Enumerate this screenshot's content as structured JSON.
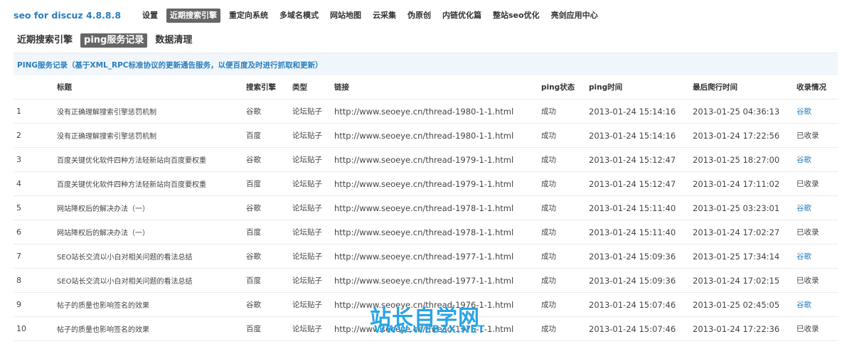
{
  "app": {
    "brand": "seo for discuz 4.8.8.8"
  },
  "topnav": [
    {
      "label": "设置",
      "active": false
    },
    {
      "label": "近期搜索引擎",
      "active": true
    },
    {
      "label": "重定向系统",
      "active": false
    },
    {
      "label": "多域名模式",
      "active": false
    },
    {
      "label": "网站地图",
      "active": false
    },
    {
      "label": "云采集",
      "active": false
    },
    {
      "label": "伪原创",
      "active": false
    },
    {
      "label": "内链优化篇",
      "active": false
    },
    {
      "label": "整站seo优化",
      "active": false
    },
    {
      "label": "亮剑应用中心",
      "active": false
    }
  ],
  "subnav": [
    {
      "label": "近期搜索引擎",
      "active": false
    },
    {
      "label": "ping服务记录",
      "active": true
    },
    {
      "label": "数据清理",
      "active": false
    }
  ],
  "panel": {
    "title": "PING服务记录（基于XML_RPC标准协议的更新通告服务，以便百度及时进行抓取和更新）"
  },
  "table": {
    "headers": [
      "",
      "标题",
      "搜索引擎",
      "类型",
      "链接",
      "ping状态",
      "ping时间",
      "最后爬行时间",
      "收录情况"
    ],
    "rows": [
      {
        "idx": "1",
        "title": "没有正确理解搜索引擎惩罚机制",
        "engine": "谷歌",
        "type": "论坛贴子",
        "link": "http://www.seoeye.cn/thread-1980-1-1.html",
        "status": "成功",
        "ping_time": "2013-01-24 15:14:16",
        "crawl_time": "2013-01-25 04:36:13",
        "included": "谷歌",
        "included_is_link": true
      },
      {
        "idx": "2",
        "title": "没有正确理解搜索引擎惩罚机制",
        "engine": "百度",
        "type": "论坛贴子",
        "link": "http://www.seoeye.cn/thread-1980-1-1.html",
        "status": "成功",
        "ping_time": "2013-01-24 15:14:16",
        "crawl_time": "2013-01-24 17:22:56",
        "included": "已收录",
        "included_is_link": false
      },
      {
        "idx": "3",
        "title": "百度关键优化软件四种方法轻新站向百度要权重",
        "engine": "谷歌",
        "type": "论坛贴子",
        "link": "http://www.seoeye.cn/thread-1979-1-1.html",
        "status": "成功",
        "ping_time": "2013-01-24 15:12:47",
        "crawl_time": "2013-01-25 18:27:00",
        "included": "谷歌",
        "included_is_link": true
      },
      {
        "idx": "4",
        "title": "百度关键优化软件四种方法轻新站向百度要权重",
        "engine": "百度",
        "type": "论坛贴子",
        "link": "http://www.seoeye.cn/thread-1979-1-1.html",
        "status": "成功",
        "ping_time": "2013-01-24 15:12:47",
        "crawl_time": "2013-01-24 17:11:02",
        "included": "巳收录",
        "included_is_link": false
      },
      {
        "idx": "5",
        "title": "网站降权后的解决办法（一）",
        "engine": "谷歌",
        "type": "论坛贴子",
        "link": "http://www.seoeye.cn/thread-1978-1-1.html",
        "status": "成功",
        "ping_time": "2013-01-24 15:11:40",
        "crawl_time": "2013-01-25 03:23:01",
        "included": "谷歌",
        "included_is_link": true
      },
      {
        "idx": "6",
        "title": "网站降权后的解决办法（一）",
        "engine": "百度",
        "type": "论坛贴子",
        "link": "http://www.seoeye.cn/thread-1978-1-1.html",
        "status": "成功",
        "ping_time": "2013-01-24 15:11:40",
        "crawl_time": "2013-01-24 17:02:27",
        "included": "已收录",
        "included_is_link": false
      },
      {
        "idx": "7",
        "title": "SEO站长交流以小白对相关问题的看法总结",
        "engine": "谷歌",
        "type": "论坛贴子",
        "link": "http://www.seoeye.cn/thread-1977-1-1.html",
        "status": "成功",
        "ping_time": "2013-01-24 15:09:36",
        "crawl_time": "2013-01-25 17:34:14",
        "included": "谷歌",
        "included_is_link": true
      },
      {
        "idx": "8",
        "title": "SEO站长交流以小白对相关问题的看法总结",
        "engine": "百度",
        "type": "论坛贴子",
        "link": "http://www.seoeye.cn/thread-1977-1-1.html",
        "status": "成功",
        "ping_time": "2013-01-24 15:09:36",
        "crawl_time": "2013-01-24 17:02:15",
        "included": "巳收录",
        "included_is_link": false
      },
      {
        "idx": "9",
        "title": "帖子的质量也影响签名的效果",
        "engine": "谷歌",
        "type": "论坛贴子",
        "link": "http://www.seoeye.cn/thread-1976-1-1.html",
        "status": "成功",
        "ping_time": "2013-01-24 15:07:46",
        "crawl_time": "2013-01-25 02:45:05",
        "included": "谷歌",
        "included_is_link": true
      },
      {
        "idx": "10",
        "title": "帖子的质量也影响签名的效果",
        "engine": "百度",
        "type": "论坛贴子",
        "link": "http://www.seoeye.cn/thread-1976-1-1.html",
        "status": "成功",
        "ping_time": "2013-01-24 15:07:46",
        "crawl_time": "2013-01-24 17:22:36",
        "included": "巳收录",
        "included_is_link": false
      }
    ]
  },
  "watermark": {
    "main": "站长自学网",
    "sub": "WWW.WEBZX.NET"
  }
}
